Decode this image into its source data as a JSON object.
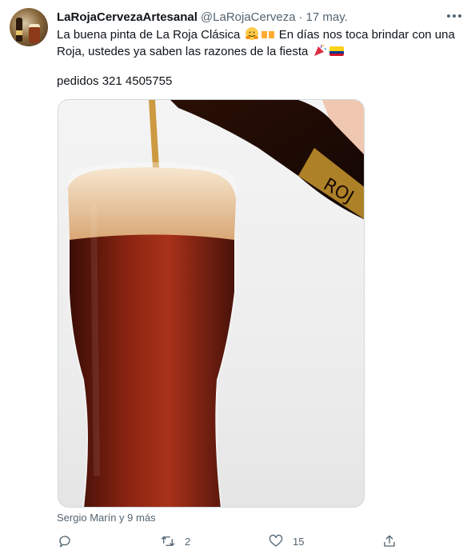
{
  "tweet": {
    "display_name": "LaRojaCervezaArtesanal",
    "handle": "@LaRojaCerveza",
    "separator": "·",
    "date": "17 may.",
    "text_line1_part1": "La buena pinta de La Roja Clásica",
    "text_line1_part2": "En días nos toca brindar con una",
    "text_line2": "Roja, ustedes ya saben las razones de la fiesta",
    "phone_line": "pedidos 321 4505755",
    "tagged": "Sergio Marín y 9 más",
    "more_icon": "more-horizontal-icon",
    "media_icon": "beer-pour-photo"
  },
  "actions": {
    "reply_count": "",
    "retweet_count": "2",
    "like_count": "15"
  },
  "colors": {
    "text": "#0f1419",
    "secondary": "#536471",
    "beer": "#7a1f12",
    "foam": "#e8c9a0",
    "flag_yellow": "#fcd116",
    "flag_blue": "#003893",
    "flag_red": "#ce1126"
  }
}
